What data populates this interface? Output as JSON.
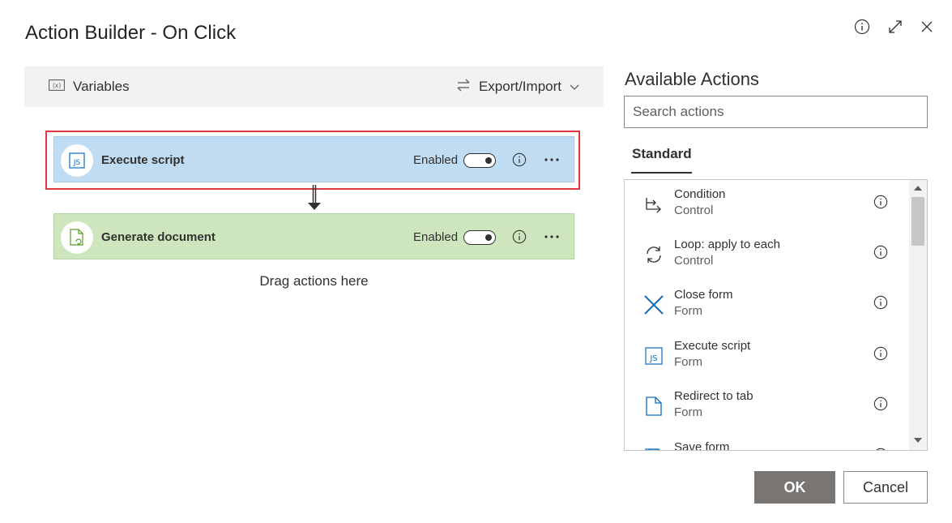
{
  "dialog": {
    "title": "Action Builder - On Click"
  },
  "toolbar": {
    "variables_label": "Variables",
    "export_import_label": "Export/Import"
  },
  "canvas": {
    "actions": [
      {
        "label": "Execute script",
        "status": "Enabled",
        "enabled": true,
        "icon": "js-file-icon"
      },
      {
        "label": "Generate document",
        "status": "Enabled",
        "enabled": true,
        "icon": "generate-document-icon"
      }
    ],
    "drop_hint": "Drag actions here"
  },
  "available": {
    "title": "Available Actions",
    "search_placeholder": "Search actions",
    "tab": "Standard",
    "items": [
      {
        "name": "Condition",
        "category": "Control",
        "icon": "condition-icon"
      },
      {
        "name": "Loop: apply to each",
        "category": "Control",
        "icon": "loop-icon"
      },
      {
        "name": "Close form",
        "category": "Form",
        "icon": "close-x-icon"
      },
      {
        "name": "Execute script",
        "category": "Form",
        "icon": "js-file-icon"
      },
      {
        "name": "Redirect to tab",
        "category": "Form",
        "icon": "page-icon"
      },
      {
        "name": "Save form",
        "category": "",
        "icon": "save-icon"
      }
    ]
  },
  "footer": {
    "ok_label": "OK",
    "cancel_label": "Cancel"
  },
  "colors": {
    "selected_card": "#c0dcf3",
    "generate_card": "#cde6be",
    "selection_outline": "#e0373e",
    "ok_button": "#797573",
    "icon_blue": "#0f6cbd",
    "icon_green": "#5aa02c"
  }
}
